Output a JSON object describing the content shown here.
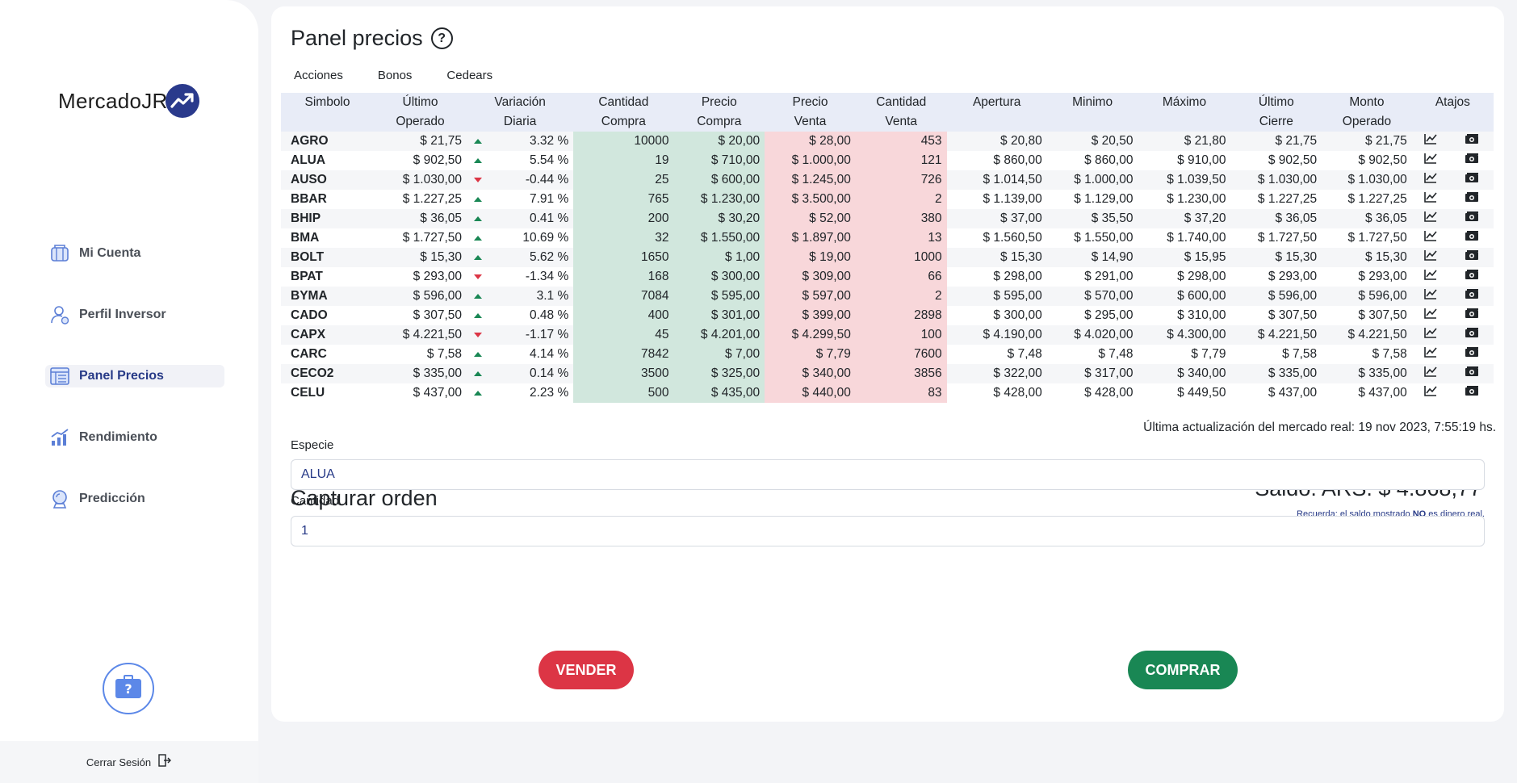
{
  "brand": {
    "name": "MercadoJR",
    "logo_icon": "trend-up-icon",
    "badge_color": "#2a3a8c"
  },
  "sidebar": {
    "items": [
      {
        "label": "Mi Cuenta",
        "icon": "wallet-icon",
        "active": false
      },
      {
        "label": "Perfil Inversor",
        "icon": "user-icon",
        "active": false
      },
      {
        "label": "Panel Precios",
        "icon": "price-list-icon",
        "active": true
      },
      {
        "label": "Rendimiento",
        "icon": "chart-icon",
        "active": false
      },
      {
        "label": "Predicción",
        "icon": "crystal-ball-icon",
        "active": false
      }
    ],
    "help_icon": "briefcase-question-icon",
    "logout_label": "Cerrar Sesión",
    "logout_icon": "logout-icon"
  },
  "panel": {
    "title": "Panel precios",
    "tabs": [
      "Acciones",
      "Bonos",
      "Cedears"
    ]
  },
  "table": {
    "headers": [
      [
        "Simbolo",
        ""
      ],
      [
        "Último",
        "Operado"
      ],
      [
        "Variación",
        "Diaria"
      ],
      [
        "Cantidad",
        "Compra"
      ],
      [
        "Precio",
        "Compra"
      ],
      [
        "Precio",
        "Venta"
      ],
      [
        "Cantidad",
        "Venta"
      ],
      [
        "Apertura",
        ""
      ],
      [
        "Minimo",
        ""
      ],
      [
        "Máximo",
        ""
      ],
      [
        "Último",
        "Cierre"
      ],
      [
        "Monto",
        "Operado"
      ],
      [
        "Atajos",
        ""
      ]
    ],
    "rows": [
      {
        "symbol": "AGRO",
        "last": "$ 21,75",
        "dir": "up",
        "var": "3.32 %",
        "qbuy": "10000",
        "pbuy": "$ 20,00",
        "psell": "$ 28,00",
        "qsell": "453",
        "open": "$ 20,80",
        "min": "$ 20,50",
        "max": "$ 21,80",
        "close": "$ 21,75",
        "amount": "$ 21,75"
      },
      {
        "symbol": "ALUA",
        "last": "$ 902,50",
        "dir": "up",
        "var": "5.54 %",
        "qbuy": "19",
        "pbuy": "$ 710,00",
        "psell": "$ 1.000,00",
        "qsell": "121",
        "open": "$ 860,00",
        "min": "$ 860,00",
        "max": "$ 910,00",
        "close": "$ 902,50",
        "amount": "$ 902,50"
      },
      {
        "symbol": "AUSO",
        "last": "$ 1.030,00",
        "dir": "down",
        "var": "-0.44 %",
        "qbuy": "25",
        "pbuy": "$ 600,00",
        "psell": "$ 1.245,00",
        "qsell": "726",
        "open": "$ 1.014,50",
        "min": "$ 1.000,00",
        "max": "$ 1.039,50",
        "close": "$ 1.030,00",
        "amount": "$ 1.030,00"
      },
      {
        "symbol": "BBAR",
        "last": "$ 1.227,25",
        "dir": "up",
        "var": "7.91 %",
        "qbuy": "765",
        "pbuy": "$ 1.230,00",
        "psell": "$ 3.500,00",
        "qsell": "2",
        "open": "$ 1.139,00",
        "min": "$ 1.129,00",
        "max": "$ 1.230,00",
        "close": "$ 1.227,25",
        "amount": "$ 1.227,25"
      },
      {
        "symbol": "BHIP",
        "last": "$ 36,05",
        "dir": "up",
        "var": "0.41 %",
        "qbuy": "200",
        "pbuy": "$ 30,20",
        "psell": "$ 52,00",
        "qsell": "380",
        "open": "$ 37,00",
        "min": "$ 35,50",
        "max": "$ 37,20",
        "close": "$ 36,05",
        "amount": "$ 36,05"
      },
      {
        "symbol": "BMA",
        "last": "$ 1.727,50",
        "dir": "up",
        "var": "10.69 %",
        "qbuy": "32",
        "pbuy": "$ 1.550,00",
        "psell": "$ 1.897,00",
        "qsell": "13",
        "open": "$ 1.560,50",
        "min": "$ 1.550,00",
        "max": "$ 1.740,00",
        "close": "$ 1.727,50",
        "amount": "$ 1.727,50"
      },
      {
        "symbol": "BOLT",
        "last": "$ 15,30",
        "dir": "up",
        "var": "5.62 %",
        "qbuy": "1650",
        "pbuy": "$ 1,00",
        "psell": "$ 19,00",
        "qsell": "1000",
        "open": "$ 15,30",
        "min": "$ 14,90",
        "max": "$ 15,95",
        "close": "$ 15,30",
        "amount": "$ 15,30"
      },
      {
        "symbol": "BPAT",
        "last": "$ 293,00",
        "dir": "down",
        "var": "-1.34 %",
        "qbuy": "168",
        "pbuy": "$ 300,00",
        "psell": "$ 309,00",
        "qsell": "66",
        "open": "$ 298,00",
        "min": "$ 291,00",
        "max": "$ 298,00",
        "close": "$ 293,00",
        "amount": "$ 293,00"
      },
      {
        "symbol": "BYMA",
        "last": "$ 596,00",
        "dir": "up",
        "var": "3.1 %",
        "qbuy": "7084",
        "pbuy": "$ 595,00",
        "psell": "$ 597,00",
        "qsell": "2",
        "open": "$ 595,00",
        "min": "$ 570,00",
        "max": "$ 600,00",
        "close": "$ 596,00",
        "amount": "$ 596,00"
      },
      {
        "symbol": "CADO",
        "last": "$ 307,50",
        "dir": "up",
        "var": "0.48 %",
        "qbuy": "400",
        "pbuy": "$ 301,00",
        "psell": "$ 399,00",
        "qsell": "2898",
        "open": "$ 300,00",
        "min": "$ 295,00",
        "max": "$ 310,00",
        "close": "$ 307,50",
        "amount": "$ 307,50"
      },
      {
        "symbol": "CAPX",
        "last": "$ 4.221,50",
        "dir": "down",
        "var": "-1.17 %",
        "qbuy": "45",
        "pbuy": "$ 4.201,00",
        "psell": "$ 4.299,50",
        "qsell": "100",
        "open": "$ 4.190,00",
        "min": "$ 4.020,00",
        "max": "$ 4.300,00",
        "close": "$ 4.221,50",
        "amount": "$ 4.221,50"
      },
      {
        "symbol": "CARC",
        "last": "$ 7,58",
        "dir": "up",
        "var": "4.14 %",
        "qbuy": "7842",
        "pbuy": "$ 7,00",
        "psell": "$ 7,79",
        "qsell": "7600",
        "open": "$ 7,48",
        "min": "$ 7,48",
        "max": "$ 7,79",
        "close": "$ 7,58",
        "amount": "$ 7,58"
      },
      {
        "symbol": "CECO2",
        "last": "$ 335,00",
        "dir": "up",
        "var": "0.14 %",
        "qbuy": "3500",
        "pbuy": "$ 325,00",
        "psell": "$ 340,00",
        "qsell": "3856",
        "open": "$ 322,00",
        "min": "$ 317,00",
        "max": "$ 340,00",
        "close": "$ 335,00",
        "amount": "$ 335,00"
      },
      {
        "symbol": "CELU",
        "last": "$ 437,00",
        "dir": "up",
        "var": "2.23 %",
        "qbuy": "500",
        "pbuy": "$ 435,00",
        "psell": "$ 440,00",
        "qsell": "83",
        "open": "$ 428,00",
        "min": "$ 428,00",
        "max": "$ 449,50",
        "close": "$ 437,00",
        "amount": "$ 437,00"
      }
    ],
    "shortcut_icons": [
      "line-chart-icon",
      "money-icon"
    ],
    "last_update": "Última actualización del mercado real: 19 nov 2023, 7:55:19 hs."
  },
  "order": {
    "title": "Capturar orden",
    "balance": "Saldo: ARS. $ 4.868,77",
    "note_prefix": "Recuerda: el saldo mostrado",
    "note_bold": "NO",
    "note_suffix": "es dinero real.",
    "especie_label": "Especie",
    "especie_value": "ALUA",
    "cantidad_label": "Cantidad",
    "cantidad_value": "1",
    "sell_label": "VENDER",
    "buy_label": "COMPRAR"
  },
  "colors": {
    "accent": "#273a87",
    "buy_bg": "#d1e7dd",
    "sell_bg": "#f8d7da",
    "sell_btn": "#dc3545",
    "buy_btn": "#198754",
    "up": "#198754",
    "down": "#dc3545"
  }
}
